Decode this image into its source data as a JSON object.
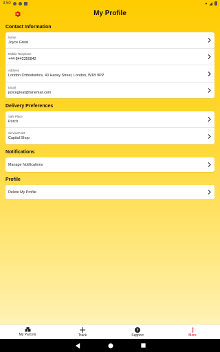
{
  "status": {
    "time": "3:50"
  },
  "header": {
    "title": "My Profile",
    "settings_icon": "gear-icon",
    "accent": "#D40511"
  },
  "sections": {
    "contact": {
      "title": "Contact Information",
      "name_label": "Name",
      "name_value": "Joyce Great",
      "phone_label": "Mobile Telephone",
      "phone_value": "+44 8442350842",
      "address_label": "Address",
      "address_value": "London Orthodontics, 40 Harley Street, London, W1B 9PP",
      "email_label": "Email",
      "email_value": "joycegreat@fanemail.com"
    },
    "delivery": {
      "title": "Delivery Preferences",
      "safe_label": "Safe Place",
      "safe_value": "Porch",
      "sp_label": "ServicePoint",
      "sp_value": "Capital Shop"
    },
    "notifications": {
      "title": "Notifications",
      "manage": "Manage Notifications"
    },
    "profile": {
      "title": "Profile",
      "delete": "Delete My Profile"
    }
  },
  "nav": {
    "parcels": "My Parcels",
    "track": "Track",
    "support": "Support",
    "more": "More"
  }
}
